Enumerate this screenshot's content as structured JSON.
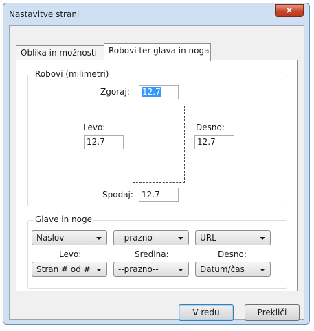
{
  "window": {
    "title": "Nastavitve strani",
    "close_glyph": "×"
  },
  "tabs": [
    {
      "label": "Oblika in možnosti",
      "selected": false
    },
    {
      "label": "Robovi ter glava in noga",
      "selected": true
    }
  ],
  "margins": {
    "legend": "Robovi (milimetri)",
    "top_label": "Zgoraj:",
    "top_value": "12.7",
    "left_label": "Levo:",
    "left_value": "12.7",
    "right_label": "Desno:",
    "right_value": "12.7",
    "bottom_label": "Spodaj:",
    "bottom_value": "12.7"
  },
  "headers_footers": {
    "legend": "Glave in noge",
    "header_left": "Naslov",
    "header_center": "--prazno--",
    "header_right": "URL",
    "col_left_label": "Levo:",
    "col_center_label": "Sredina:",
    "col_right_label": "Desno:",
    "footer_left": "Stran # od #",
    "footer_center": "--prazno--",
    "footer_right": "Datum/čas"
  },
  "buttons": {
    "ok": "V redu",
    "cancel": "Prekliči"
  }
}
